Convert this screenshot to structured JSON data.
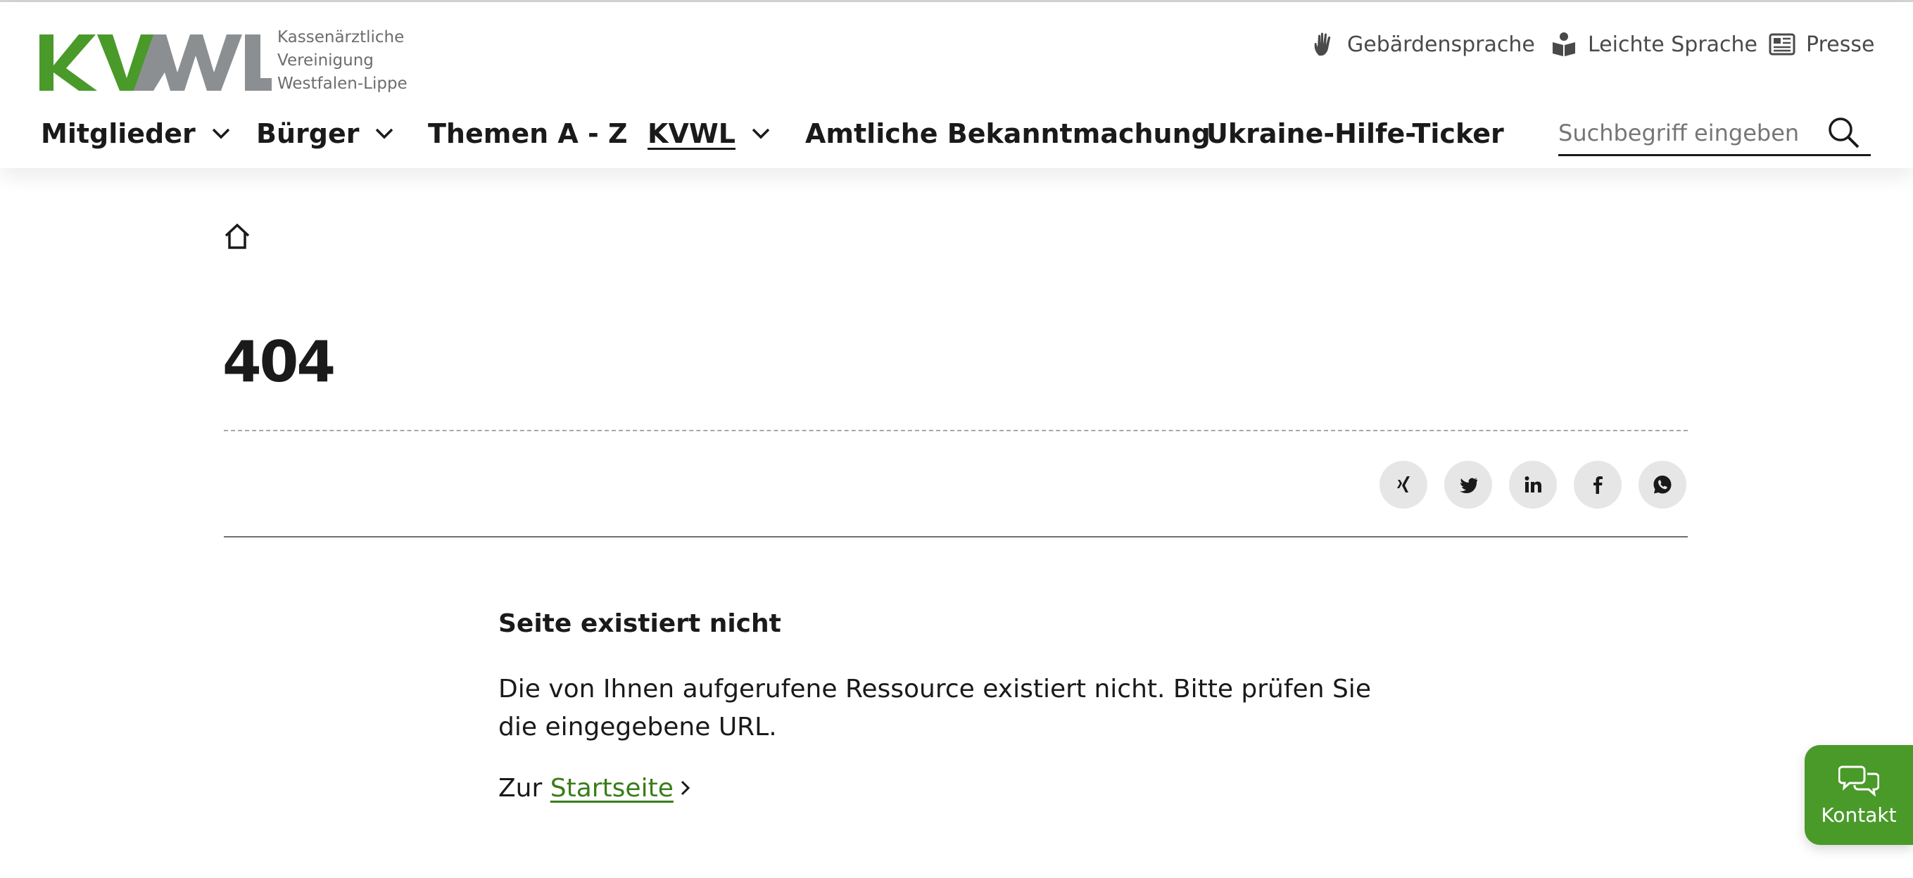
{
  "header": {
    "logo": {
      "wordmark": "KVWL",
      "lines": [
        "Kassenärztliche",
        "Vereinigung",
        "Westfalen-Lippe"
      ],
      "colors": {
        "green": "#4a9a2a",
        "gray": "#8c8f91"
      }
    },
    "service_links": [
      {
        "label": "Gebärdensprache",
        "icon": "hand-icon"
      },
      {
        "label": "Leichte Sprache",
        "icon": "easy-language-icon"
      },
      {
        "label": "Presse",
        "icon": "newspaper-icon"
      }
    ],
    "nav": [
      {
        "label": "Mitglieder",
        "has_dropdown": true,
        "active": false
      },
      {
        "label": "Bürger",
        "has_dropdown": true,
        "active": false
      },
      {
        "label": "Themen A - Z",
        "has_dropdown": false,
        "active": false
      },
      {
        "label": "KVWL",
        "has_dropdown": true,
        "active": true
      },
      {
        "label": "Amtliche Bekanntmachung",
        "has_dropdown": false,
        "active": false
      },
      {
        "label": "Ukraine-Hilfe-Ticker",
        "has_dropdown": false,
        "active": false
      }
    ],
    "search": {
      "placeholder": "Suchbegriff eingeben",
      "value": ""
    }
  },
  "main": {
    "title": "404",
    "share": [
      "xing-icon",
      "twitter-icon",
      "linkedin-icon",
      "facebook-icon",
      "whatsapp-icon"
    ],
    "message": {
      "heading": "Seite existiert nicht",
      "body": "Die von Ihnen aufgerufene Ressource existiert nicht. Bitte prüfen Sie die ein­gegebene URL.",
      "link_prefix": "Zur",
      "link_label": "Startseite"
    }
  },
  "contact_button": {
    "label": "Kontakt",
    "color": "#4a9a2a"
  },
  "colors": {
    "link": "#3a7d1a",
    "text": "#1a1a1a"
  }
}
